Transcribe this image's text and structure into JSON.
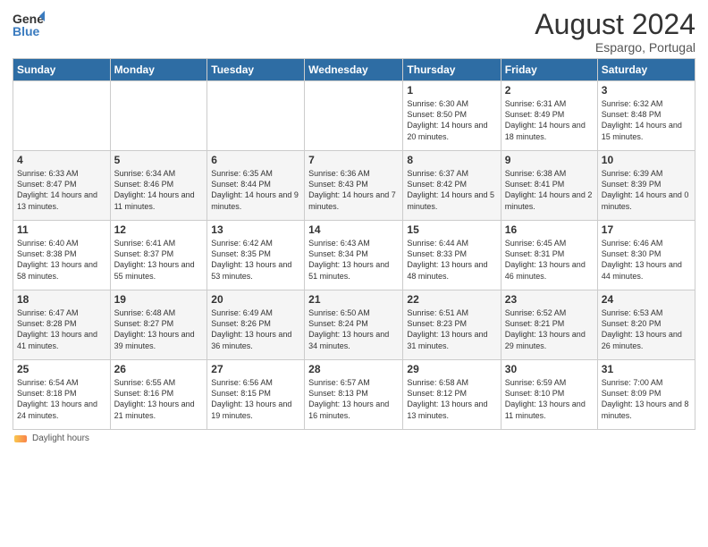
{
  "header": {
    "logo_general": "General",
    "logo_blue": "Blue",
    "main_title": "August 2024",
    "subtitle": "Espargo, Portugal"
  },
  "days_of_week": [
    "Sunday",
    "Monday",
    "Tuesday",
    "Wednesday",
    "Thursday",
    "Friday",
    "Saturday"
  ],
  "footer": {
    "label": "Daylight hours"
  },
  "weeks": [
    [
      {
        "day": "",
        "sunrise": "",
        "sunset": "",
        "daylight": ""
      },
      {
        "day": "",
        "sunrise": "",
        "sunset": "",
        "daylight": ""
      },
      {
        "day": "",
        "sunrise": "",
        "sunset": "",
        "daylight": ""
      },
      {
        "day": "",
        "sunrise": "",
        "sunset": "",
        "daylight": ""
      },
      {
        "day": "1",
        "sunrise": "Sunrise: 6:30 AM",
        "sunset": "Sunset: 8:50 PM",
        "daylight": "Daylight: 14 hours and 20 minutes."
      },
      {
        "day": "2",
        "sunrise": "Sunrise: 6:31 AM",
        "sunset": "Sunset: 8:49 PM",
        "daylight": "Daylight: 14 hours and 18 minutes."
      },
      {
        "day": "3",
        "sunrise": "Sunrise: 6:32 AM",
        "sunset": "Sunset: 8:48 PM",
        "daylight": "Daylight: 14 hours and 15 minutes."
      }
    ],
    [
      {
        "day": "4",
        "sunrise": "Sunrise: 6:33 AM",
        "sunset": "Sunset: 8:47 PM",
        "daylight": "Daylight: 14 hours and 13 minutes."
      },
      {
        "day": "5",
        "sunrise": "Sunrise: 6:34 AM",
        "sunset": "Sunset: 8:46 PM",
        "daylight": "Daylight: 14 hours and 11 minutes."
      },
      {
        "day": "6",
        "sunrise": "Sunrise: 6:35 AM",
        "sunset": "Sunset: 8:44 PM",
        "daylight": "Daylight: 14 hours and 9 minutes."
      },
      {
        "day": "7",
        "sunrise": "Sunrise: 6:36 AM",
        "sunset": "Sunset: 8:43 PM",
        "daylight": "Daylight: 14 hours and 7 minutes."
      },
      {
        "day": "8",
        "sunrise": "Sunrise: 6:37 AM",
        "sunset": "Sunset: 8:42 PM",
        "daylight": "Daylight: 14 hours and 5 minutes."
      },
      {
        "day": "9",
        "sunrise": "Sunrise: 6:38 AM",
        "sunset": "Sunset: 8:41 PM",
        "daylight": "Daylight: 14 hours and 2 minutes."
      },
      {
        "day": "10",
        "sunrise": "Sunrise: 6:39 AM",
        "sunset": "Sunset: 8:39 PM",
        "daylight": "Daylight: 14 hours and 0 minutes."
      }
    ],
    [
      {
        "day": "11",
        "sunrise": "Sunrise: 6:40 AM",
        "sunset": "Sunset: 8:38 PM",
        "daylight": "Daylight: 13 hours and 58 minutes."
      },
      {
        "day": "12",
        "sunrise": "Sunrise: 6:41 AM",
        "sunset": "Sunset: 8:37 PM",
        "daylight": "Daylight: 13 hours and 55 minutes."
      },
      {
        "day": "13",
        "sunrise": "Sunrise: 6:42 AM",
        "sunset": "Sunset: 8:35 PM",
        "daylight": "Daylight: 13 hours and 53 minutes."
      },
      {
        "day": "14",
        "sunrise": "Sunrise: 6:43 AM",
        "sunset": "Sunset: 8:34 PM",
        "daylight": "Daylight: 13 hours and 51 minutes."
      },
      {
        "day": "15",
        "sunrise": "Sunrise: 6:44 AM",
        "sunset": "Sunset: 8:33 PM",
        "daylight": "Daylight: 13 hours and 48 minutes."
      },
      {
        "day": "16",
        "sunrise": "Sunrise: 6:45 AM",
        "sunset": "Sunset: 8:31 PM",
        "daylight": "Daylight: 13 hours and 46 minutes."
      },
      {
        "day": "17",
        "sunrise": "Sunrise: 6:46 AM",
        "sunset": "Sunset: 8:30 PM",
        "daylight": "Daylight: 13 hours and 44 minutes."
      }
    ],
    [
      {
        "day": "18",
        "sunrise": "Sunrise: 6:47 AM",
        "sunset": "Sunset: 8:28 PM",
        "daylight": "Daylight: 13 hours and 41 minutes."
      },
      {
        "day": "19",
        "sunrise": "Sunrise: 6:48 AM",
        "sunset": "Sunset: 8:27 PM",
        "daylight": "Daylight: 13 hours and 39 minutes."
      },
      {
        "day": "20",
        "sunrise": "Sunrise: 6:49 AM",
        "sunset": "Sunset: 8:26 PM",
        "daylight": "Daylight: 13 hours and 36 minutes."
      },
      {
        "day": "21",
        "sunrise": "Sunrise: 6:50 AM",
        "sunset": "Sunset: 8:24 PM",
        "daylight": "Daylight: 13 hours and 34 minutes."
      },
      {
        "day": "22",
        "sunrise": "Sunrise: 6:51 AM",
        "sunset": "Sunset: 8:23 PM",
        "daylight": "Daylight: 13 hours and 31 minutes."
      },
      {
        "day": "23",
        "sunrise": "Sunrise: 6:52 AM",
        "sunset": "Sunset: 8:21 PM",
        "daylight": "Daylight: 13 hours and 29 minutes."
      },
      {
        "day": "24",
        "sunrise": "Sunrise: 6:53 AM",
        "sunset": "Sunset: 8:20 PM",
        "daylight": "Daylight: 13 hours and 26 minutes."
      }
    ],
    [
      {
        "day": "25",
        "sunrise": "Sunrise: 6:54 AM",
        "sunset": "Sunset: 8:18 PM",
        "daylight": "Daylight: 13 hours and 24 minutes."
      },
      {
        "day": "26",
        "sunrise": "Sunrise: 6:55 AM",
        "sunset": "Sunset: 8:16 PM",
        "daylight": "Daylight: 13 hours and 21 minutes."
      },
      {
        "day": "27",
        "sunrise": "Sunrise: 6:56 AM",
        "sunset": "Sunset: 8:15 PM",
        "daylight": "Daylight: 13 hours and 19 minutes."
      },
      {
        "day": "28",
        "sunrise": "Sunrise: 6:57 AM",
        "sunset": "Sunset: 8:13 PM",
        "daylight": "Daylight: 13 hours and 16 minutes."
      },
      {
        "day": "29",
        "sunrise": "Sunrise: 6:58 AM",
        "sunset": "Sunset: 8:12 PM",
        "daylight": "Daylight: 13 hours and 13 minutes."
      },
      {
        "day": "30",
        "sunrise": "Sunrise: 6:59 AM",
        "sunset": "Sunset: 8:10 PM",
        "daylight": "Daylight: 13 hours and 11 minutes."
      },
      {
        "day": "31",
        "sunrise": "Sunrise: 7:00 AM",
        "sunset": "Sunset: 8:09 PM",
        "daylight": "Daylight: 13 hours and 8 minutes."
      }
    ]
  ]
}
